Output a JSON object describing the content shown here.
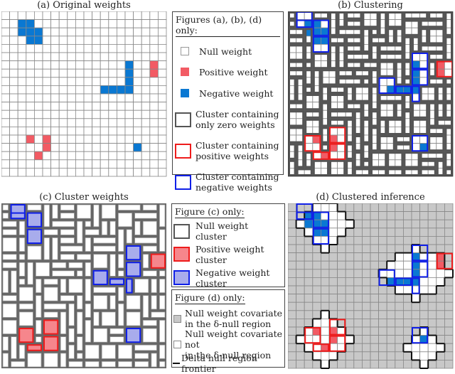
{
  "panels": {
    "a": {
      "title": "(a) Original weights"
    },
    "b": {
      "title": "(b) Clustering"
    },
    "c": {
      "title": "(c) Cluster weights"
    },
    "d": {
      "title": "(d) Clustered inference"
    }
  },
  "legend_abd": {
    "heading": "Figures (a), (b), (d) only:",
    "items": [
      {
        "label": "Null weight",
        "kind": "null"
      },
      {
        "label": "Positive weight",
        "kind": "positive"
      },
      {
        "label": "Negative weight",
        "kind": "negative"
      },
      {
        "label": "Cluster containing only zero weights",
        "line1": "Cluster containing",
        "line2": "only zero weights",
        "kind": "cluster-zero"
      },
      {
        "label": "Cluster containing positive weights",
        "line1": "Cluster containing",
        "line2": "positive weights",
        "kind": "cluster-positive"
      },
      {
        "label": "Cluster containing negative weights",
        "line1": "Cluster containing",
        "line2": "negative weights",
        "kind": "cluster-negative"
      }
    ]
  },
  "legend_c": {
    "heading": "Figure (c) only:",
    "items": [
      {
        "line1": "Null weight",
        "line2": "cluster"
      },
      {
        "line1": "Positive weight",
        "line2": "cluster"
      },
      {
        "line1": "Negative weight",
        "line2": "cluster"
      }
    ]
  },
  "legend_d": {
    "heading": "Figure (d) only:",
    "items": [
      {
        "line1": "Null weight covariate",
        "line2": "in the δ-null region"
      },
      {
        "line1": "Null weight covariate not",
        "line2": "in the δ-null region"
      },
      {
        "line1": "Delta null region frontier"
      }
    ]
  },
  "colors": {
    "positive": "#f25b64",
    "negative": "#0a78d2",
    "positive_border": "#ee1c1c",
    "negative_border": "#1020e8",
    "positive_cluster_fill": "#f6868c",
    "negative_cluster_fill": "#a8acec",
    "null_region": "#c8c8c8",
    "cluster_border": "#555555"
  },
  "grid": {
    "size": 20,
    "negative_cells": [
      [
        1,
        2
      ],
      [
        1,
        3
      ],
      [
        2,
        2
      ],
      [
        2,
        3
      ],
      [
        2,
        4
      ],
      [
        3,
        3
      ],
      [
        3,
        4
      ],
      [
        6,
        15
      ],
      [
        7,
        15
      ],
      [
        8,
        15
      ],
      [
        9,
        12
      ],
      [
        9,
        13
      ],
      [
        9,
        14
      ],
      [
        9,
        15
      ],
      [
        16,
        16
      ]
    ],
    "positive_cells": [
      [
        6,
        18
      ],
      [
        7,
        18
      ],
      [
        15,
        3
      ],
      [
        15,
        5
      ],
      [
        16,
        5
      ],
      [
        17,
        4
      ]
    ]
  }
}
